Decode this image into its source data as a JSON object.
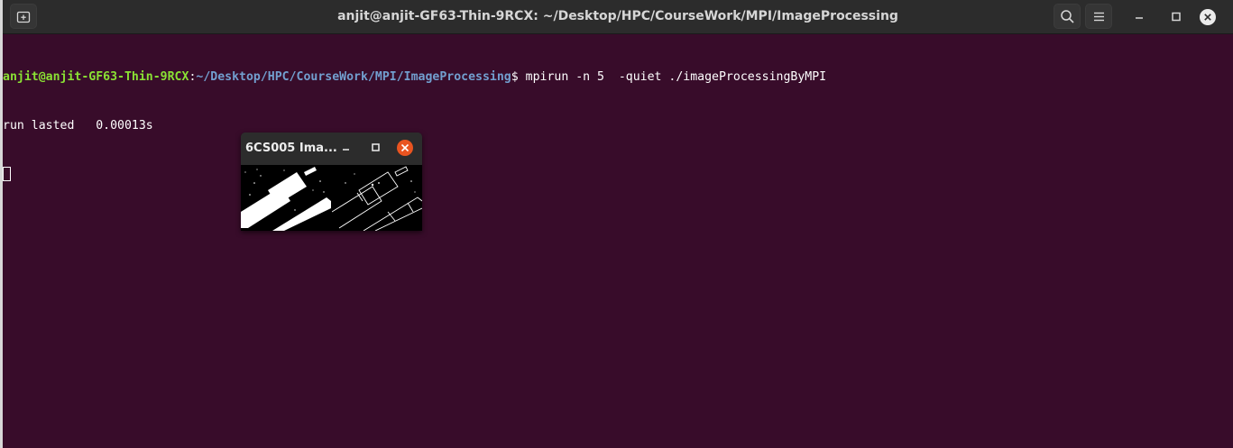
{
  "window": {
    "title": "anjit@anjit-GF63-Thin-9RCX: ~/Desktop/HPC/CourseWork/MPI/ImageProcessing",
    "icons": {
      "new_tab": "new-tab-icon",
      "search": "search-icon",
      "menu": "hamburger-menu-icon",
      "minimize": "minimize-icon",
      "maximize": "maximize-icon",
      "close": "close-icon"
    },
    "colors": {
      "terminal_bg": "#380c2a",
      "titlebar_bg": "#2c2c2c",
      "prompt_user": "#8ae234",
      "prompt_path": "#729fcf",
      "close_accent": "#e95420"
    }
  },
  "terminal": {
    "prompt_user_host": "anjit@anjit-GF63-Thin-9RCX",
    "prompt_sep": ":",
    "prompt_path": "~/Desktop/HPC/CourseWork/MPI/ImageProcessing",
    "prompt_symbol": "$",
    "command": " mpirun -n 5  -quiet ./imageProcessingByMPI",
    "output_line": "run lasted   0.00013s"
  },
  "image_window": {
    "title": "6CS005 Ima...",
    "panels": [
      "original-binary-image",
      "edge-detected-image"
    ]
  }
}
